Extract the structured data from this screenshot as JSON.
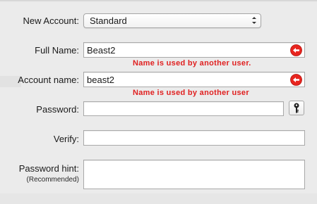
{
  "form": {
    "new_account": {
      "label": "New Account:",
      "value": "Standard"
    },
    "full_name": {
      "label": "Full Name:",
      "value": "Beast2",
      "error": "Name is used by another user."
    },
    "account_name": {
      "label": "Account name:",
      "value": "beast2",
      "error": "Name is used by another user"
    },
    "password": {
      "label": "Password:",
      "value": ""
    },
    "verify": {
      "label": "Verify:",
      "value": ""
    },
    "password_hint": {
      "label": "Password hint:",
      "sublabel": "(Recommended)",
      "value": ""
    }
  },
  "icons": {
    "error": "error-icon",
    "key": "key-icon",
    "popup_arrows": "chevron-updown-icon"
  },
  "colors": {
    "error": "#e02020",
    "background": "#ebebeb",
    "field_border": "#a9a9a9"
  }
}
